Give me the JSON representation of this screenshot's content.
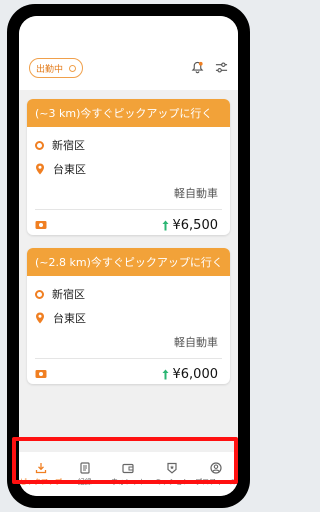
{
  "header": {
    "status_label": "出勤中",
    "icons": [
      "bell-icon",
      "filter-sliders-icon"
    ]
  },
  "colors": {
    "accent": "#f2a239",
    "accent_dark": "#f07f22",
    "fare_arrow": "#2bb673",
    "highlight_frame": "#ff1010"
  },
  "orders": [
    {
      "title": "(~3 km)今すぐピックアップに行く",
      "pickup": "新宿区",
      "dropoff": "台東区",
      "vehicle": "軽自動車",
      "fare": "¥6,500"
    },
    {
      "title": "(~2.8 km)今すぐピックアップに行く",
      "pickup": "新宿区",
      "dropoff": "台東区",
      "vehicle": "軽自動車",
      "fare": "¥6,000"
    }
  ],
  "nav": {
    "items": [
      {
        "label": "ピックアップ",
        "icon": "download-icon",
        "active": true
      },
      {
        "label": "記録",
        "icon": "document-icon",
        "active": false
      },
      {
        "label": "ウォレット",
        "icon": "wallet-icon",
        "active": false
      },
      {
        "label": "ミッション",
        "icon": "shield-star-icon",
        "active": false
      },
      {
        "label": "プロフィール",
        "icon": "user-circle-icon",
        "active": false
      }
    ]
  }
}
